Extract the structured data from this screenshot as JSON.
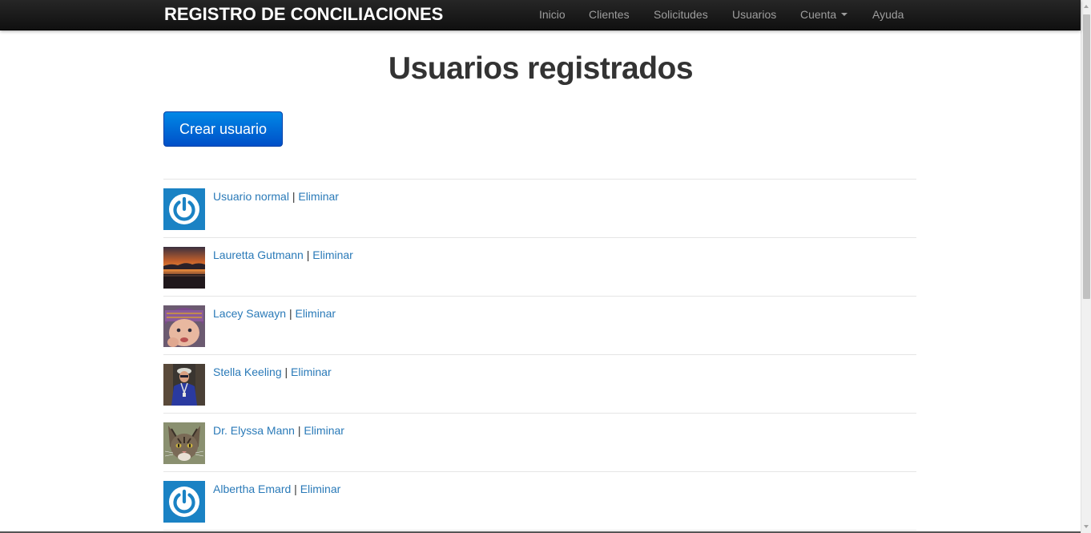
{
  "navbar": {
    "brand": "REGISTRO DE CONCILIACIONES",
    "items": [
      {
        "label": "Inicio"
      },
      {
        "label": "Clientes"
      },
      {
        "label": "Solicitudes"
      },
      {
        "label": "Usuarios"
      },
      {
        "label": "Cuenta"
      },
      {
        "label": "Ayuda"
      }
    ]
  },
  "main": {
    "title": "Usuarios registrados",
    "create_button": "Crear usuario",
    "users": [
      {
        "name": "Usuario normal",
        "delete": "Eliminar",
        "avatar": "power-icon"
      },
      {
        "name": "Lauretta Gutmann",
        "delete": "Eliminar",
        "avatar": "sunset-photo"
      },
      {
        "name": "Lacey Sawayn",
        "delete": "Eliminar",
        "avatar": "child-photo"
      },
      {
        "name": "Stella Keeling",
        "delete": "Eliminar",
        "avatar": "person-photo"
      },
      {
        "name": "Dr. Elyssa Mann",
        "delete": "Eliminar",
        "avatar": "cat-photo"
      },
      {
        "name": "Albertha Emard",
        "delete": "Eliminar",
        "avatar": "power-icon"
      }
    ],
    "separator": "|"
  },
  "colors": {
    "navbar_bg": "#1b1b1b",
    "link": "#2a7ab8",
    "primary_button": "#0070d8",
    "default_avatar": "#1a82c4"
  }
}
